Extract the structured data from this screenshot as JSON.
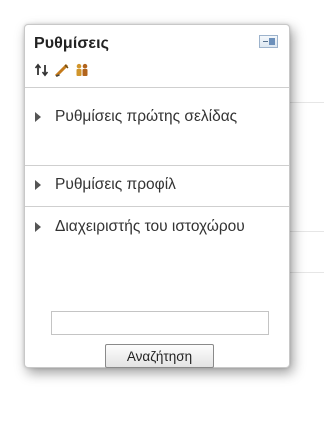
{
  "block": {
    "title": "Ρυθμίσεις",
    "dock_icon": "dock-panel-icon",
    "tool_icons": [
      "move-icon",
      "edit-icon",
      "roles-icon"
    ]
  },
  "menu": {
    "items": [
      {
        "label": "Ρυθμίσεις πρώτης σελίδας",
        "icon": "expand-arrow-icon"
      },
      {
        "label": "Ρυθμίσεις προφίλ",
        "icon": "expand-arrow-icon"
      },
      {
        "label": "Διαχειριστής του ιστοχώρου",
        "icon": "expand-arrow-icon"
      }
    ]
  },
  "search": {
    "value": "",
    "button_label": "Αναζήτηση"
  },
  "colors": {
    "border": "#c8c8c8",
    "text": "#333333",
    "icon_blue": "#6c90bb"
  }
}
